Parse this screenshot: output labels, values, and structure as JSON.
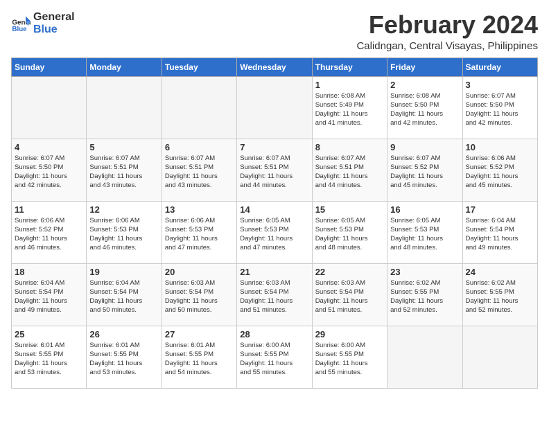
{
  "header": {
    "logo_general": "General",
    "logo_blue": "Blue",
    "month_year": "February 2024",
    "location": "Calidngan, Central Visayas, Philippines"
  },
  "days_of_week": [
    "Sunday",
    "Monday",
    "Tuesday",
    "Wednesday",
    "Thursday",
    "Friday",
    "Saturday"
  ],
  "weeks": [
    [
      {
        "day": "",
        "detail": ""
      },
      {
        "day": "",
        "detail": ""
      },
      {
        "day": "",
        "detail": ""
      },
      {
        "day": "",
        "detail": ""
      },
      {
        "day": "1",
        "detail": "Sunrise: 6:08 AM\nSunset: 5:49 PM\nDaylight: 11 hours\nand 41 minutes."
      },
      {
        "day": "2",
        "detail": "Sunrise: 6:08 AM\nSunset: 5:50 PM\nDaylight: 11 hours\nand 42 minutes."
      },
      {
        "day": "3",
        "detail": "Sunrise: 6:07 AM\nSunset: 5:50 PM\nDaylight: 11 hours\nand 42 minutes."
      }
    ],
    [
      {
        "day": "4",
        "detail": "Sunrise: 6:07 AM\nSunset: 5:50 PM\nDaylight: 11 hours\nand 42 minutes."
      },
      {
        "day": "5",
        "detail": "Sunrise: 6:07 AM\nSunset: 5:51 PM\nDaylight: 11 hours\nand 43 minutes."
      },
      {
        "day": "6",
        "detail": "Sunrise: 6:07 AM\nSunset: 5:51 PM\nDaylight: 11 hours\nand 43 minutes."
      },
      {
        "day": "7",
        "detail": "Sunrise: 6:07 AM\nSunset: 5:51 PM\nDaylight: 11 hours\nand 44 minutes."
      },
      {
        "day": "8",
        "detail": "Sunrise: 6:07 AM\nSunset: 5:51 PM\nDaylight: 11 hours\nand 44 minutes."
      },
      {
        "day": "9",
        "detail": "Sunrise: 6:07 AM\nSunset: 5:52 PM\nDaylight: 11 hours\nand 45 minutes."
      },
      {
        "day": "10",
        "detail": "Sunrise: 6:06 AM\nSunset: 5:52 PM\nDaylight: 11 hours\nand 45 minutes."
      }
    ],
    [
      {
        "day": "11",
        "detail": "Sunrise: 6:06 AM\nSunset: 5:52 PM\nDaylight: 11 hours\nand 46 minutes."
      },
      {
        "day": "12",
        "detail": "Sunrise: 6:06 AM\nSunset: 5:53 PM\nDaylight: 11 hours\nand 46 minutes."
      },
      {
        "day": "13",
        "detail": "Sunrise: 6:06 AM\nSunset: 5:53 PM\nDaylight: 11 hours\nand 47 minutes."
      },
      {
        "day": "14",
        "detail": "Sunrise: 6:05 AM\nSunset: 5:53 PM\nDaylight: 11 hours\nand 47 minutes."
      },
      {
        "day": "15",
        "detail": "Sunrise: 6:05 AM\nSunset: 5:53 PM\nDaylight: 11 hours\nand 48 minutes."
      },
      {
        "day": "16",
        "detail": "Sunrise: 6:05 AM\nSunset: 5:53 PM\nDaylight: 11 hours\nand 48 minutes."
      },
      {
        "day": "17",
        "detail": "Sunrise: 6:04 AM\nSunset: 5:54 PM\nDaylight: 11 hours\nand 49 minutes."
      }
    ],
    [
      {
        "day": "18",
        "detail": "Sunrise: 6:04 AM\nSunset: 5:54 PM\nDaylight: 11 hours\nand 49 minutes."
      },
      {
        "day": "19",
        "detail": "Sunrise: 6:04 AM\nSunset: 5:54 PM\nDaylight: 11 hours\nand 50 minutes."
      },
      {
        "day": "20",
        "detail": "Sunrise: 6:03 AM\nSunset: 5:54 PM\nDaylight: 11 hours\nand 50 minutes."
      },
      {
        "day": "21",
        "detail": "Sunrise: 6:03 AM\nSunset: 5:54 PM\nDaylight: 11 hours\nand 51 minutes."
      },
      {
        "day": "22",
        "detail": "Sunrise: 6:03 AM\nSunset: 5:54 PM\nDaylight: 11 hours\nand 51 minutes."
      },
      {
        "day": "23",
        "detail": "Sunrise: 6:02 AM\nSunset: 5:55 PM\nDaylight: 11 hours\nand 52 minutes."
      },
      {
        "day": "24",
        "detail": "Sunrise: 6:02 AM\nSunset: 5:55 PM\nDaylight: 11 hours\nand 52 minutes."
      }
    ],
    [
      {
        "day": "25",
        "detail": "Sunrise: 6:01 AM\nSunset: 5:55 PM\nDaylight: 11 hours\nand 53 minutes."
      },
      {
        "day": "26",
        "detail": "Sunrise: 6:01 AM\nSunset: 5:55 PM\nDaylight: 11 hours\nand 53 minutes."
      },
      {
        "day": "27",
        "detail": "Sunrise: 6:01 AM\nSunset: 5:55 PM\nDaylight: 11 hours\nand 54 minutes."
      },
      {
        "day": "28",
        "detail": "Sunrise: 6:00 AM\nSunset: 5:55 PM\nDaylight: 11 hours\nand 55 minutes."
      },
      {
        "day": "29",
        "detail": "Sunrise: 6:00 AM\nSunset: 5:55 PM\nDaylight: 11 hours\nand 55 minutes."
      },
      {
        "day": "",
        "detail": ""
      },
      {
        "day": "",
        "detail": ""
      }
    ]
  ]
}
